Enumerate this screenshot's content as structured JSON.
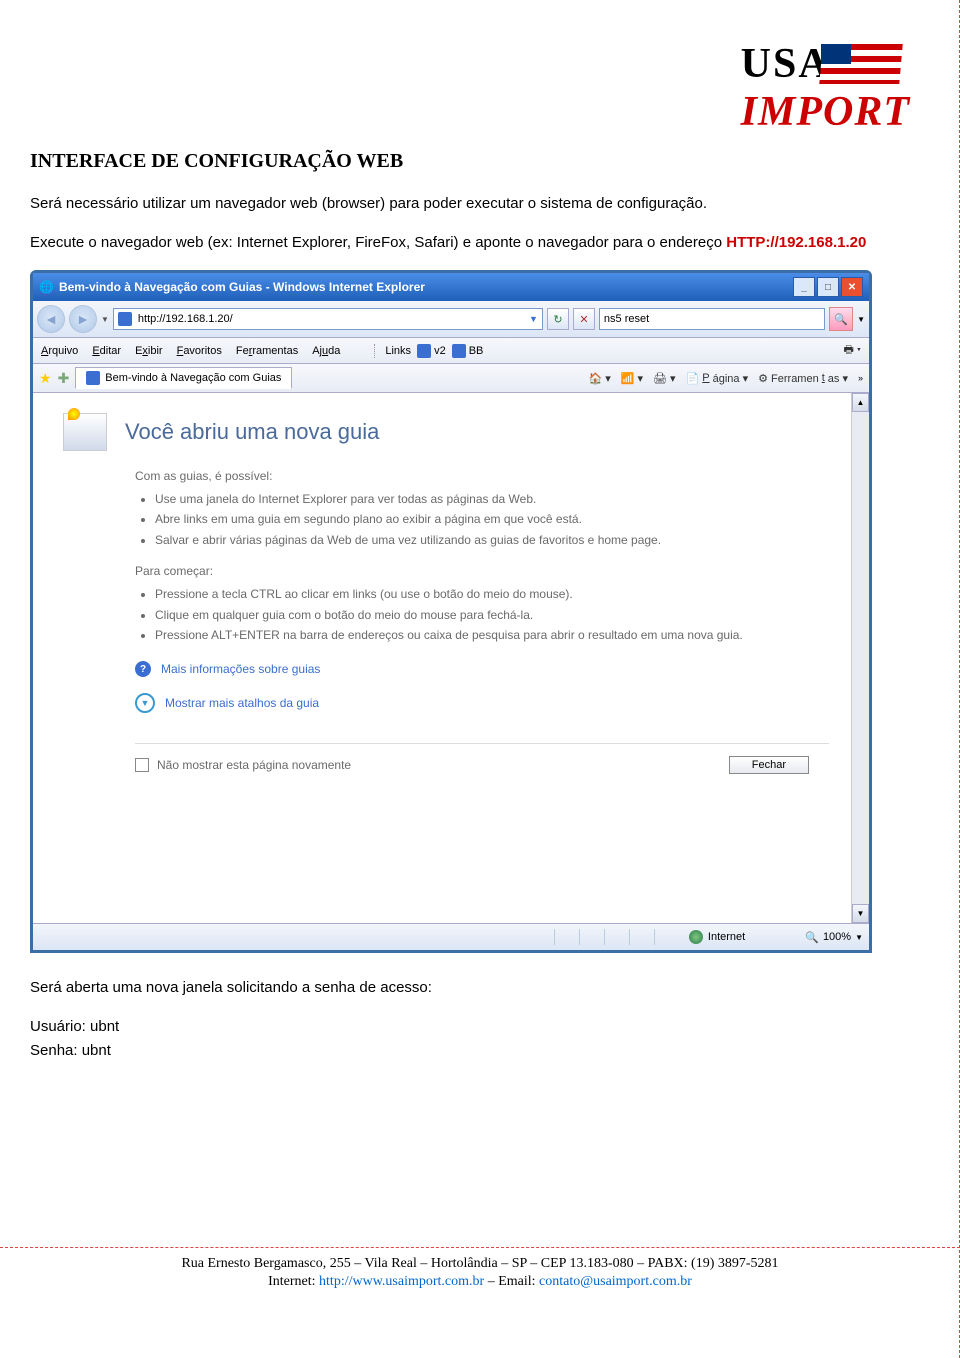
{
  "logo": {
    "line1": "USA",
    "line2": "IMPORT"
  },
  "doc": {
    "heading": "INTERFACE DE CONFIGURAÇÃO WEB",
    "p1": "Será necessário utilizar um navegador web (browser) para poder executar o sistema de configuração.",
    "p2a": "Execute o navegador web (ex: Internet Explorer, FireFox, Safari) e aponte o navegador para o endereço ",
    "p2url": "HTTP://192.168.1.20",
    "p3": "Será aberta uma nova janela solicitando a senha de acesso:",
    "p4": "Usuário: ubnt",
    "p5": "Senha: ubnt"
  },
  "ie": {
    "title": "Bem-vindo à Navegação com Guias - Windows Internet Explorer",
    "address": "http://192.168.1.20/",
    "search": "ns5 reset",
    "menu": {
      "arquivo": "Arquivo",
      "editar": "Editar",
      "exibir": "Exibir",
      "favoritos": "Favoritos",
      "ferramentas": "Ferramentas",
      "ajuda": "Ajuda"
    },
    "links": {
      "label": "Links",
      "v2": "v2",
      "bb": "BB"
    },
    "tab": "Bem-vindo à Navegação com Guias",
    "toolbar": {
      "pagina": "Página",
      "ferramentas": "Ferramentas"
    },
    "content": {
      "title": "Você abriu uma nova guia",
      "sec1": "Com as guias, é possível:",
      "b1": "Use uma janela do Internet Explorer para ver todas as páginas da Web.",
      "b2": "Abre links em uma guia em segundo plano ao exibir a página em que você está.",
      "b3": "Salvar e abrir várias páginas da Web de uma vez utilizando as guias de favoritos e home page.",
      "sec2": "Para começar:",
      "c1": "Pressione a tecla CTRL ao clicar em links (ou use o botão do meio do mouse).",
      "c2": "Clique em qualquer guia com o botão do meio do mouse para fechá-la.",
      "c3": "Pressione ALT+ENTER na barra de endereços ou caixa de pesquisa para abrir o resultado em uma nova guia.",
      "link1": "Mais informações sobre guias",
      "link2": "Mostrar mais atalhos da guia",
      "dontshow": "Não mostrar esta página novamente",
      "close": "Fechar"
    },
    "status": {
      "zone": "Internet",
      "zoom": "100%"
    }
  },
  "footer": {
    "line1": "Rua Ernesto Bergamasco, 255 – Vila Real – Hortolândia – SP – CEP 13.183-080 – PABX: (19) 3897-5281",
    "line2a": "Internet: ",
    "web": "http://www.usaimport.com.br",
    "line2b": " – Email: ",
    "mail": "contato@usaimport.com.br"
  }
}
